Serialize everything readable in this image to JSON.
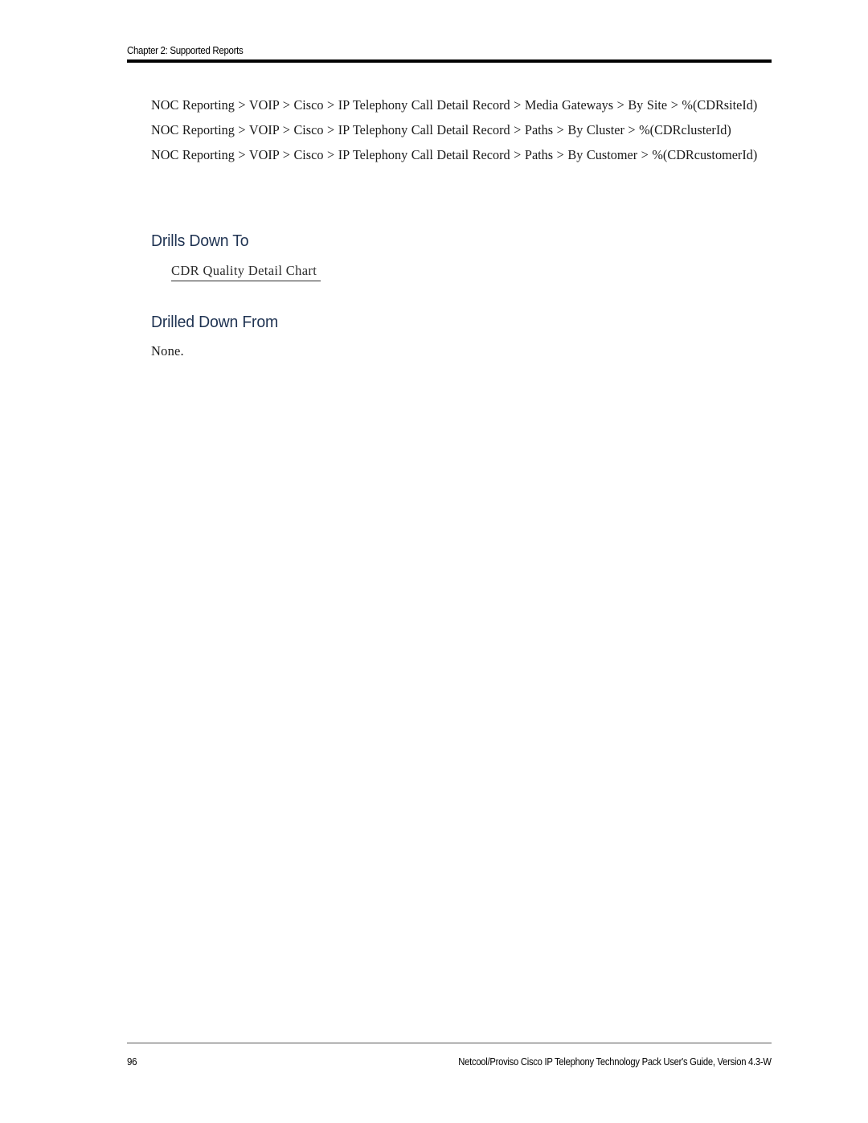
{
  "document": {
    "running_header": "Chapter 2: Supported Reports",
    "page_number": "96",
    "footer_title": "Netcool/Proviso Cisco IP Telephony Technology Pack User's Guide, Version 4.3-W",
    "heading_color": "#1F3352",
    "body_text_color": "#1A1A1A"
  },
  "breadcrumbs": [
    {
      "text": "NOC Reporting >  VOIP >  Cisco >  IP Telephony Call Detail Record >  Media Gateways >  By Site >  %(CDRsiteId)"
    },
    {
      "text": "NOC Reporting >  VOIP >  Cisco >  IP Telephony Call Detail Record >  Paths >  By Cluster >  %(CDRclusterId)"
    },
    {
      "text": "NOC Reporting >  VOIP >  Cisco >  IP Telephony Call Detail Record >  Paths >  By Customer >  %(CDRcustomerId)"
    }
  ],
  "sections": {
    "drills_down_to": {
      "heading": "Drills Down To",
      "link_label": "CDR Quality Detail Chart"
    },
    "drilled_down_from": {
      "heading": "Drilled Down From",
      "value": "None."
    }
  }
}
